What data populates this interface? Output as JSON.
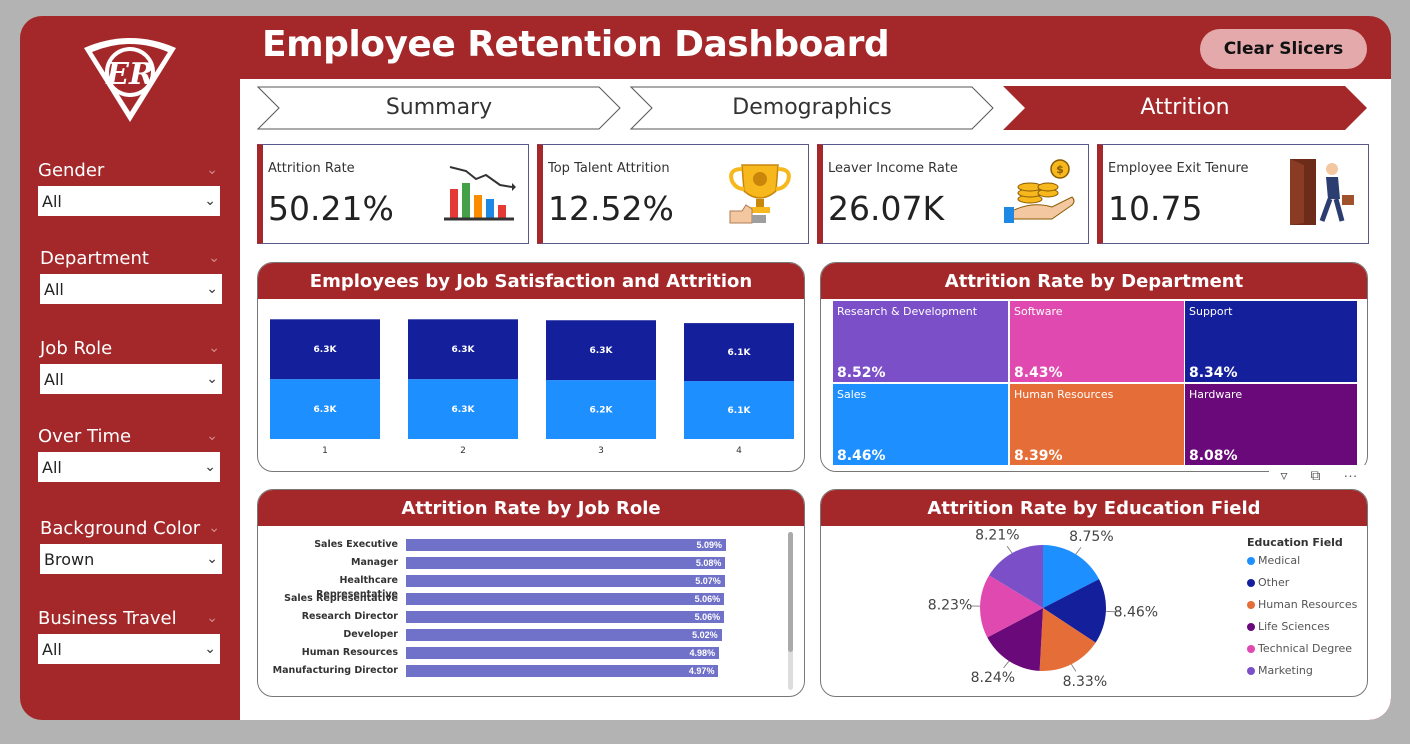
{
  "header": {
    "title": "Employee Retention Dashboard",
    "clear_label": "Clear Slicers",
    "logo_text": "ER"
  },
  "slicers": [
    {
      "label": "Gender",
      "value": "All"
    },
    {
      "label": "Department",
      "value": "All"
    },
    {
      "label": "Job Role",
      "value": "All"
    },
    {
      "label": "Over Time",
      "value": "All"
    },
    {
      "label": "Background Color",
      "value": "Brown"
    },
    {
      "label": "Business Travel",
      "value": "All"
    }
  ],
  "nav": [
    {
      "label": "Summary",
      "active": false
    },
    {
      "label": "Demographics",
      "active": false
    },
    {
      "label": "Attrition",
      "active": true
    }
  ],
  "kpis": [
    {
      "label": "Attrition Rate",
      "value": "50.21%",
      "icon": "bar-chart-down-icon"
    },
    {
      "label": "Top Talent Attrition",
      "value": "12.52%",
      "icon": "trophy-icon"
    },
    {
      "label": "Leaver Income Rate",
      "value": "26.07K",
      "icon": "coins-hand-icon"
    },
    {
      "label": "Employee Exit Tenure",
      "value": "10.75",
      "icon": "exit-door-icon"
    }
  ],
  "colors": {
    "brand": "#a4282a",
    "dark_blue": "#14209b",
    "light_blue": "#1e8fff",
    "bar_purple": "#7071c8"
  },
  "chart_data": [
    {
      "type": "bar",
      "title": "Employees by Job Satisfaction and Attrition",
      "stacked": true,
      "categories": [
        "1",
        "2",
        "3",
        "4"
      ],
      "series": [
        {
          "values": [
            6.3,
            6.3,
            6.2,
            6.1
          ],
          "labels": [
            "6.3K",
            "6.3K",
            "6.2K",
            "6.1K"
          ],
          "color": "#1e8fff"
        },
        {
          "values": [
            6.3,
            6.3,
            6.3,
            6.1
          ],
          "labels": [
            "6.3K",
            "6.3K",
            "6.3K",
            "6.1K"
          ],
          "color": "#14209b"
        }
      ]
    },
    {
      "type": "heatmap",
      "title": "Attrition Rate by Department",
      "items": [
        {
          "name": "Research & Development",
          "value": "8.52%",
          "color": "#7b4fc8"
        },
        {
          "name": "Software",
          "value": "8.43%",
          "color": "#e04ab0"
        },
        {
          "name": "Support",
          "value": "8.34%",
          "color": "#14209b"
        },
        {
          "name": "Sales",
          "value": "8.46%",
          "color": "#1e8fff"
        },
        {
          "name": "Human Resources",
          "value": "8.39%",
          "color": "#e56d37"
        },
        {
          "name": "Hardware",
          "value": "8.08%",
          "color": "#6a0a7a"
        }
      ]
    },
    {
      "type": "bar",
      "orientation": "horizontal",
      "title": "Attrition Rate by Job Role",
      "categories": [
        "Sales Executive",
        "Manager",
        "Healthcare Representative",
        "Sales Representative",
        "Research Director",
        "Developer",
        "Human Resources",
        "Manufacturing Director"
      ],
      "values": [
        5.09,
        5.08,
        5.07,
        5.06,
        5.06,
        5.02,
        4.98,
        4.97
      ],
      "labels": [
        "5.09%",
        "5.08%",
        "5.07%",
        "5.06%",
        "5.06%",
        "5.02%",
        "4.98%",
        "4.97%"
      ]
    },
    {
      "type": "pie",
      "title": "Attrition Rate by Education Field",
      "legend_title": "Education Field",
      "slices": [
        {
          "name": "Medical",
          "value": 8.75,
          "label": "8.75%",
          "color": "#1e8fff"
        },
        {
          "name": "Other",
          "value": 8.46,
          "label": "8.46%",
          "color": "#14209b"
        },
        {
          "name": "Human Resources",
          "value": 8.33,
          "label": "8.33%",
          "color": "#e56d37"
        },
        {
          "name": "Life Sciences",
          "value": 8.24,
          "label": "8.24%",
          "color": "#6a0a7a"
        },
        {
          "name": "Technical Degree",
          "value": 8.23,
          "label": "8.23%",
          "color": "#e04ab0"
        },
        {
          "name": "Marketing",
          "value": 8.21,
          "label": "8.21%",
          "color": "#7b4fc8"
        }
      ]
    }
  ]
}
